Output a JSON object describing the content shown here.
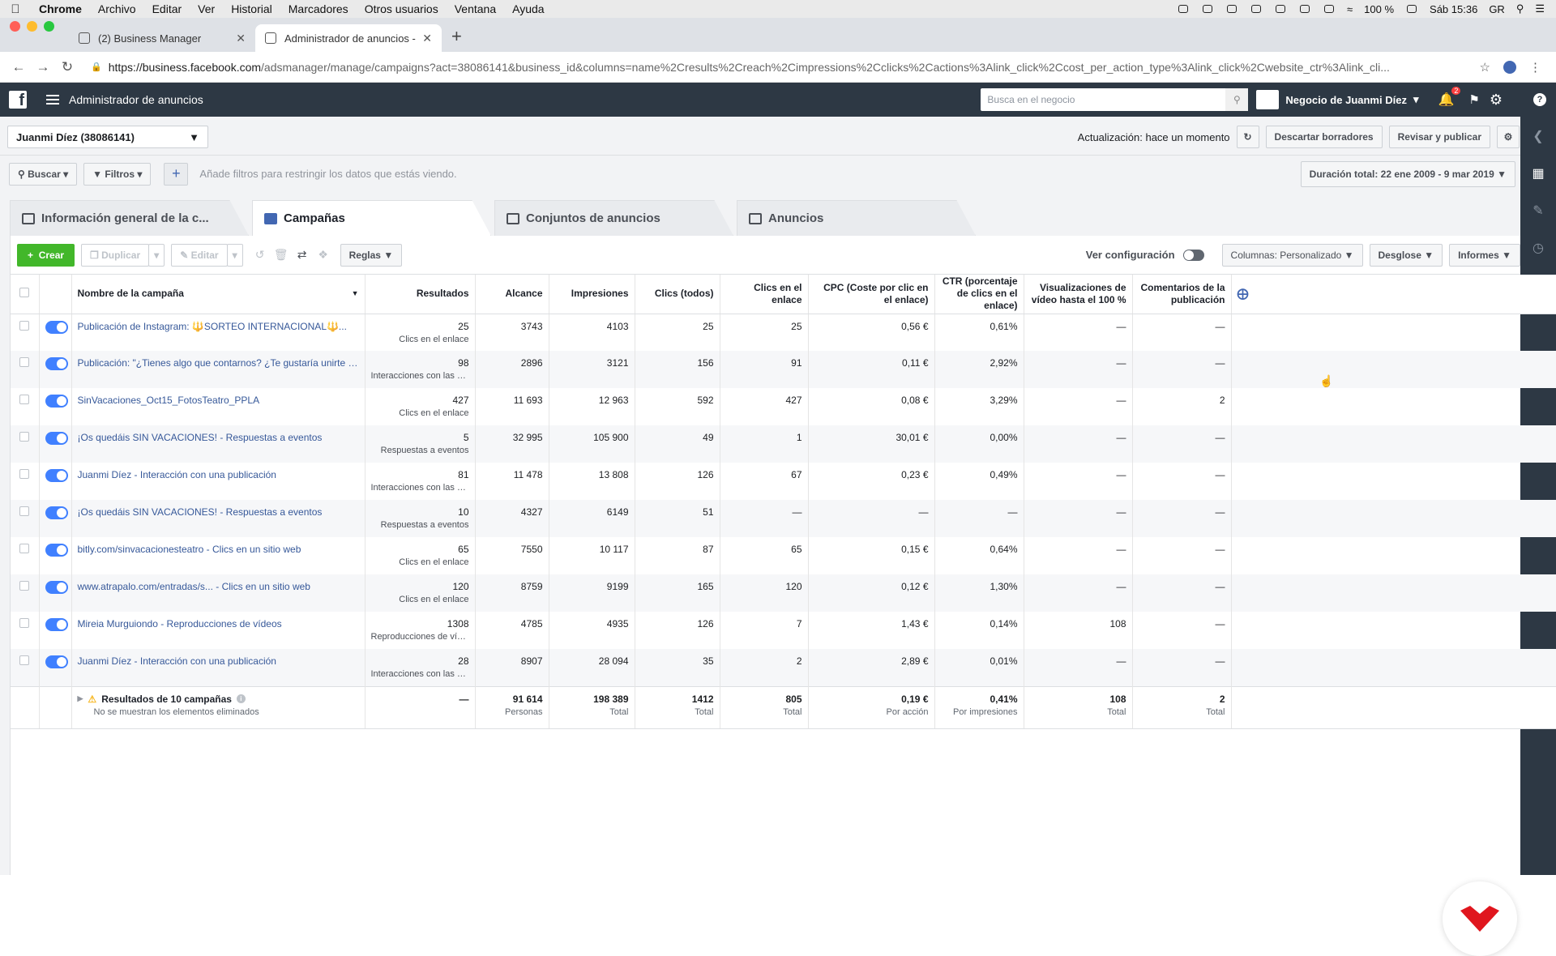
{
  "menubar": {
    "app": "Chrome",
    "items": [
      "Archivo",
      "Editar",
      "Ver",
      "Historial",
      "Marcadores",
      "Otros usuarios",
      "Ventana",
      "Ayuda"
    ],
    "battery": "100 %",
    "clock": "Sáb 15:36",
    "locale": "GR"
  },
  "browser": {
    "tabs": [
      {
        "label": "(2) Business Manager",
        "active": false
      },
      {
        "label": "Administrador de anuncios - A",
        "active": true
      }
    ],
    "url_host": "https://business.facebook.com",
    "url_rest": "/adsmanager/manage/campaigns?act=38086141&business_id&columns=name%2Cresults%2Creach%2Cimpressions%2Cclicks%2Cactions%3Alink_click%2Ccost_per_action_type%3Alink_click%2Cwebsite_ctr%3Alink_cli..."
  },
  "fbbar": {
    "title": "Administrador de anuncios",
    "search_placeholder": "Busca en el negocio",
    "business": "Negocio de Juanmi Díez",
    "notif_count": "2"
  },
  "account": {
    "name": "Juanmi Díez (38086141)",
    "update": "Actualización: hace un momento",
    "discard": "Descartar borradores",
    "review": "Revisar y publicar"
  },
  "filters": {
    "search": "Buscar",
    "filters": "Filtros",
    "hint": "Añade filtros para restringir los datos que estás viendo.",
    "date": "Duración total: 22 ene 2009 - 9 mar 2019"
  },
  "tabs": [
    {
      "label": "Información general de la c...",
      "active": false
    },
    {
      "label": "Campañas",
      "active": true
    },
    {
      "label": "Conjuntos de anuncios",
      "active": false
    },
    {
      "label": "Anuncios",
      "active": false
    }
  ],
  "actions": {
    "create": "Crear",
    "duplicate": "Duplicar",
    "edit": "Editar",
    "rules": "Reglas",
    "view_config": "Ver configuración",
    "columns": "Columnas: Personalizado",
    "breakdown": "Desglose",
    "reports": "Informes"
  },
  "table": {
    "headers": {
      "name": "Nombre de la campaña",
      "results": "Resultados",
      "reach": "Alcance",
      "impressions": "Impresiones",
      "clicks": "Clics (todos)",
      "link_clicks": "Clics en el enlace",
      "cpc": "CPC (Coste por clic en el enlace)",
      "ctr": "CTR (porcentaje de clics en el enlace)",
      "video100": "Visualizaciones de vídeo hasta el 100 %",
      "comments": "Comentarios de la publicación"
    },
    "rows": [
      {
        "name": "Publicación de Instagram: 🔱SORTEO INTERNACIONAL🔱...",
        "results": "25",
        "results_sub": "Clics en el enlace",
        "reach": "3743",
        "impressions": "4103",
        "clicks": "25",
        "link_clicks": "25",
        "cpc": "0,56 €",
        "ctr": "0,61%",
        "video100": "—",
        "comments": "—"
      },
      {
        "name": "Publicación: \"¿Tienes algo que contarnos? ¿Te gustaría unirte a...\"",
        "results": "98",
        "results_sub": "Interacciones con las publi...",
        "reach": "2896",
        "impressions": "3121",
        "clicks": "156",
        "link_clicks": "91",
        "cpc": "0,11 €",
        "ctr": "2,92%",
        "video100": "—",
        "comments": "—"
      },
      {
        "name": "SinVacaciones_Oct15_FotosTeatro_PPLA",
        "results": "427",
        "results_sub": "Clics en el enlace",
        "reach": "11 693",
        "impressions": "12 963",
        "clicks": "592",
        "link_clicks": "427",
        "cpc": "0,08 €",
        "ctr": "3,29%",
        "video100": "—",
        "comments": "2"
      },
      {
        "name": "¡Os quedáis SIN VACACIONES! - Respuestas a eventos",
        "results": "5",
        "results_sub": "Respuestas a eventos",
        "reach": "32 995",
        "impressions": "105 900",
        "clicks": "49",
        "link_clicks": "1",
        "cpc": "30,01 €",
        "ctr": "0,00%",
        "video100": "—",
        "comments": "—"
      },
      {
        "name": "Juanmi Díez - Interacción con una publicación",
        "results": "81",
        "results_sub": "Interacciones con las publi...",
        "reach": "11 478",
        "impressions": "13 808",
        "clicks": "126",
        "link_clicks": "67",
        "cpc": "0,23 €",
        "ctr": "0,49%",
        "video100": "—",
        "comments": "—"
      },
      {
        "name": "¡Os quedáis SIN VACACIONES! - Respuestas a eventos",
        "results": "10",
        "results_sub": "Respuestas a eventos",
        "reach": "4327",
        "impressions": "6149",
        "clicks": "51",
        "link_clicks": "—",
        "cpc": "—",
        "ctr": "—",
        "video100": "—",
        "comments": "—"
      },
      {
        "name": "bitly.com/sinvacacionesteatro - Clics en un sitio web",
        "results": "65",
        "results_sub": "Clics en el enlace",
        "reach": "7550",
        "impressions": "10 117",
        "clicks": "87",
        "link_clicks": "65",
        "cpc": "0,15 €",
        "ctr": "0,64%",
        "video100": "—",
        "comments": "—"
      },
      {
        "name": "www.atrapalo.com/entradas/s... - Clics en un sitio web",
        "results": "120",
        "results_sub": "Clics en el enlace",
        "reach": "8759",
        "impressions": "9199",
        "clicks": "165",
        "link_clicks": "120",
        "cpc": "0,12 €",
        "ctr": "1,30%",
        "video100": "—",
        "comments": "—"
      },
      {
        "name": "Mireia Murguiondo - Reproducciones de vídeos",
        "results": "1308",
        "results_sub": "Reproducciones de vídeo ...",
        "reach": "4785",
        "impressions": "4935",
        "clicks": "126",
        "link_clicks": "7",
        "cpc": "1,43 €",
        "ctr": "0,14%",
        "video100": "108",
        "comments": "—"
      },
      {
        "name": "Juanmi Díez - Interacción con una publicación",
        "results": "28",
        "results_sub": "Interacciones con las publi...",
        "reach": "8907",
        "impressions": "28 094",
        "clicks": "35",
        "link_clicks": "2",
        "cpc": "2,89 €",
        "ctr": "0,01%",
        "video100": "—",
        "comments": "—"
      }
    ],
    "totals": {
      "name": "Resultados de 10 campañas",
      "name_sub": "No se muestran los elementos eliminados",
      "results": "—",
      "reach": "91 614",
      "reach_sub": "Personas",
      "impressions": "198 389",
      "impressions_sub": "Total",
      "clicks": "1412",
      "clicks_sub": "Total",
      "link_clicks": "805",
      "link_clicks_sub": "Total",
      "cpc": "0,19 €",
      "cpc_sub": "Por acción",
      "ctr": "0,41%",
      "ctr_sub": "Por impresiones",
      "video100": "108",
      "video100_sub": "Total",
      "comments": "2",
      "comments_sub": "Total"
    }
  },
  "colors": {
    "fb_bar": "#2d3844",
    "create_green": "#42b72a",
    "link_blue": "#365899",
    "toggle_blue": "#4080ff",
    "logo_red": "#e0161e"
  }
}
